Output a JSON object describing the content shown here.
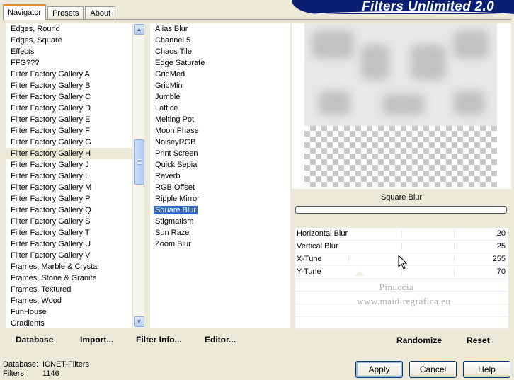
{
  "tabs": [
    "Navigator",
    "Presets",
    "About"
  ],
  "banner_title": "Filters Unlimited 2.0",
  "categories": [
    "Edges, Round",
    "Edges, Square",
    "Effects",
    "FFG???",
    "Filter Factory Gallery A",
    "Filter Factory Gallery B",
    "Filter Factory Gallery C",
    "Filter Factory Gallery D",
    "Filter Factory Gallery E",
    "Filter Factory Gallery F",
    "Filter Factory Gallery G",
    "Filter Factory Gallery H",
    "Filter Factory Gallery J",
    "Filter Factory Gallery L",
    "Filter Factory Gallery M",
    "Filter Factory Gallery P",
    "Filter Factory Gallery Q",
    "Filter Factory Gallery S",
    "Filter Factory Gallery T",
    "Filter Factory Gallery U",
    "Filter Factory Gallery V",
    "Frames, Marble & Crystal",
    "Frames, Stone & Granite",
    "Frames, Textured",
    "Frames, Wood",
    "FunHouse",
    "Gradients"
  ],
  "selected_category": "Filter Factory Gallery H",
  "filters": [
    "Alias Blur",
    "Channel 5",
    "Chaos Tile",
    "Edge Saturate",
    "GridMed",
    "GridMin",
    "Jumble",
    "Lattice",
    "Melting Pot",
    "Moon Phase",
    "NoiseyRGB",
    "Print Screen",
    "Quick Sepia",
    "Reverb",
    "RGB Offset",
    "Ripple Mirror",
    "Square Blur",
    "Stigmatism",
    "Sun Raze",
    "Zoom Blur"
  ],
  "selected_filter": "Square Blur",
  "filter_name": "Square Blur",
  "progress": 0,
  "sliders": [
    {
      "label": "Horizontal Blur",
      "value": "20"
    },
    {
      "label": "Vertical Blur",
      "value": "25"
    },
    {
      "label": "X-Tune",
      "value": "255"
    },
    {
      "label": "Y-Tune",
      "value": "70"
    }
  ],
  "watermark": {
    "line1": "Pinuccia",
    "line2": "www.maidiregrafica.eu"
  },
  "left_buttons": {
    "database": "Database",
    "import": "Import...",
    "filter_info": "Filter Info...",
    "editor": "Editor..."
  },
  "right_buttons": {
    "randomize": "Randomize",
    "reset": "Reset"
  },
  "status": {
    "database_label": "Database:",
    "database_value": "ICNET-Filters",
    "filters_label": "Filters:",
    "filters_value": "1146"
  },
  "dialog_buttons": {
    "apply": "Apply",
    "cancel": "Cancel",
    "help": "Help"
  },
  "icons": {
    "scroll_up": "chevron-up-icon",
    "scroll_down": "chevron-down-icon",
    "cursor": "mouse-pointer-icon"
  }
}
